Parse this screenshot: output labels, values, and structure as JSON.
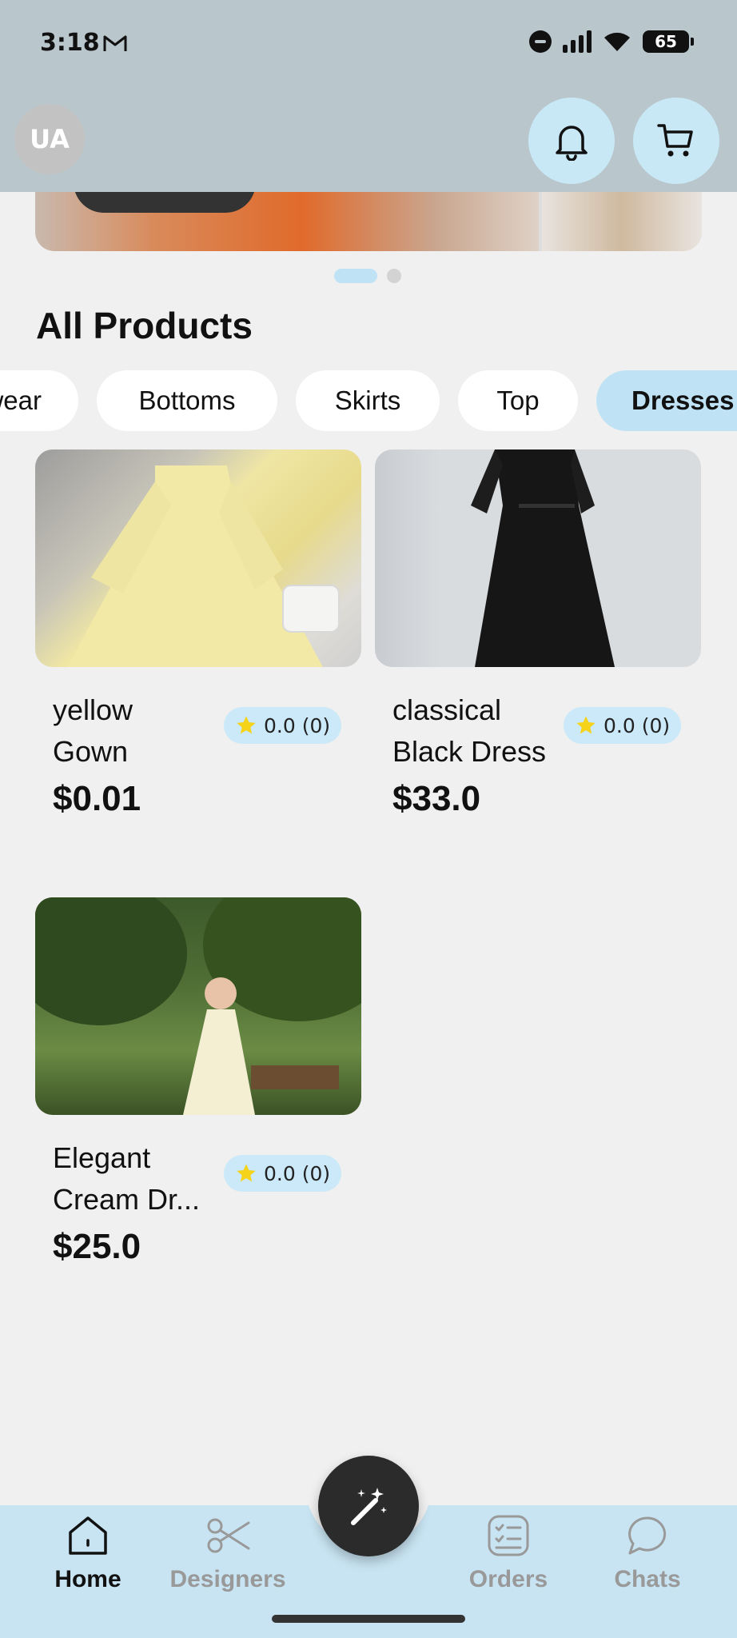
{
  "status_bar": {
    "time": "3:18",
    "battery": "65"
  },
  "header": {
    "avatar_initials": "UA"
  },
  "section": {
    "title": "All Products"
  },
  "categories": [
    {
      "label": "wear"
    },
    {
      "label": "Bottoms"
    },
    {
      "label": "Skirts"
    },
    {
      "label": "Top"
    },
    {
      "label": "Dresses",
      "active": true
    }
  ],
  "products": [
    {
      "name": "yellow Gown",
      "rating": "0.0",
      "reviews": "(0)",
      "price": "$0.01"
    },
    {
      "name": "classical Black Dress",
      "rating": "0.0",
      "reviews": "(0)",
      "price": "$33.0"
    },
    {
      "name": "Elegant Cream Dr...",
      "rating": "0.0",
      "reviews": "(0)",
      "price": "$25.0"
    }
  ],
  "nav": {
    "items": [
      {
        "label": "Home",
        "icon": "home-icon",
        "active": true
      },
      {
        "label": "Designers",
        "icon": "scissors-icon"
      },
      {
        "label": "Orders",
        "icon": "orders-icon"
      },
      {
        "label": "Chats",
        "icon": "chat-icon"
      }
    ],
    "fab_icon": "magic-wand-icon"
  },
  "colors": {
    "accent": "#bfe3f5",
    "header_bg": "#b9c6cc",
    "nav_bg": "#c8e4f2",
    "fab_bg": "#2b2b2b",
    "star": "#f6d31b"
  }
}
